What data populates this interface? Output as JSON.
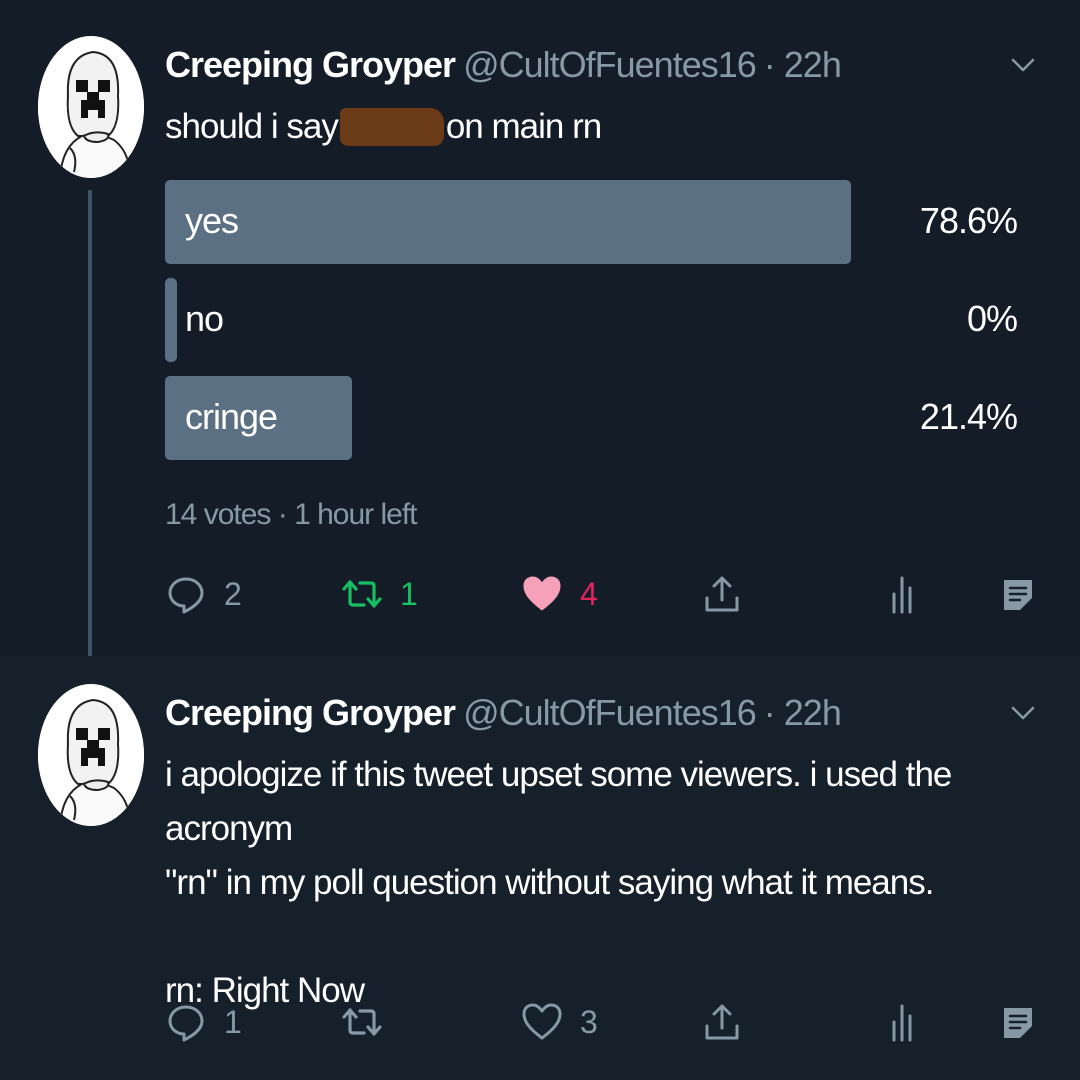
{
  "colors": {
    "background": "#15202b",
    "secondary_text": "#8899a6",
    "poll_bar": "#5b7083",
    "retweet_active": "#17bf63",
    "like_active": "#e0245e",
    "redaction": "#6b3a16"
  },
  "tweets": [
    {
      "author": {
        "name": "Creeping Groyper",
        "handle": "@CultOfFuentes16",
        "time": "· 22h"
      },
      "text_before": "should i say",
      "text_after": "on main rn",
      "poll": {
        "options": [
          {
            "label": "yes",
            "percent_text": "78.6%",
            "value": 78.6
          },
          {
            "label": "no",
            "percent_text": "0%",
            "value": 0
          },
          {
            "label": "cringe",
            "percent_text": "21.4%",
            "value": 21.4
          }
        ],
        "summary": "14 votes · 1 hour left"
      },
      "actions": {
        "reply_count": "2",
        "retweet_count": "1",
        "like_count": "4",
        "retweeted": true,
        "liked": true
      }
    },
    {
      "author": {
        "name": "Creeping Groyper",
        "handle": "@CultOfFuentes16",
        "time": "· 22h"
      },
      "text_lines": [
        "i apologize if this tweet upset some viewers. i used the acronym",
        "\"rn\" in my poll question without saying what it means.",
        "",
        "rn: Right Now"
      ],
      "actions": {
        "reply_count": "1",
        "retweet_count": "",
        "like_count": "3",
        "retweeted": false,
        "liked": false
      }
    }
  ],
  "icons": {
    "reply": "reply-icon",
    "retweet": "retweet-icon",
    "like": "heart-icon",
    "share": "share-icon",
    "analytics": "analytics-icon",
    "notes": "notes-icon",
    "menu": "chevron-down-icon"
  }
}
